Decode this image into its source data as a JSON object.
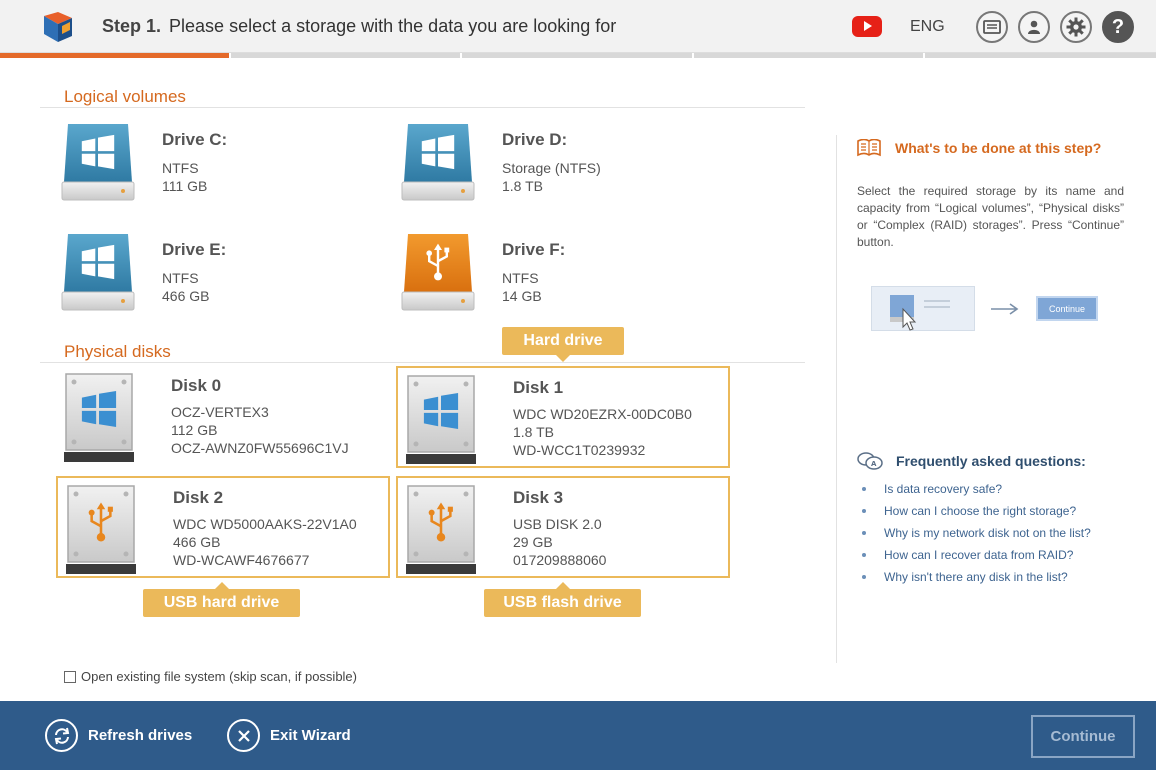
{
  "header": {
    "step_label": "Step 1.",
    "step_text": "Please select a storage with the data you are looking for",
    "language": "ENG",
    "icons": [
      "youtube-icon",
      "log-icon",
      "account-icon",
      "settings-icon",
      "help-icon"
    ],
    "help_glyph": "?"
  },
  "progress": {
    "fraction": 0.2
  },
  "logical_volumes": {
    "title": "Logical volumes",
    "drives": [
      {
        "name": "Drive C:",
        "fs": "NTFS",
        "size": "111 GB",
        "icon": "windows-drive-icon"
      },
      {
        "name": "Drive D:",
        "fs": "Storage (NTFS)",
        "size": "1.8 TB",
        "icon": "windows-drive-icon"
      },
      {
        "name": "Drive E:",
        "fs": "NTFS",
        "size": "466 GB",
        "icon": "windows-drive-icon"
      },
      {
        "name": "Drive F:",
        "fs": "NTFS",
        "size": "14 GB",
        "icon": "usb-drive-icon"
      }
    ]
  },
  "physical_disks": {
    "title": "Physical disks",
    "disks": [
      {
        "name": "Disk 0",
        "model": "OCZ-VERTEX3",
        "size": "112 GB",
        "serial": "OCZ-AWNZ0FW55696C1VJ",
        "icon": "windows-hdd-icon"
      },
      {
        "name": "Disk 1",
        "model": "WDC WD20EZRX-00DC0B0",
        "size": "1.8 TB",
        "serial": "WD-WCC1T0239932",
        "icon": "windows-hdd-icon"
      },
      {
        "name": "Disk 2",
        "model": "WDC WD5000AAKS-22V1A0",
        "size": "466 GB",
        "serial": "WD-WCAWF4676677",
        "icon": "usb-hdd-icon"
      },
      {
        "name": "Disk 3",
        "model": "USB DISK 2.0",
        "size": "29 GB",
        "serial": "017209888060",
        "icon": "usb-hdd-icon"
      }
    ]
  },
  "callouts": {
    "hard_drive": "Hard drive",
    "usb_hard_drive": "USB hard drive",
    "usb_flash_drive": "USB flash drive"
  },
  "options": {
    "open_existing_fs": "Open existing file system (skip scan, if possible)",
    "open_existing_fs_checked": false
  },
  "help": {
    "title": "What's to be done at this step?",
    "text": "Select the required storage by its name and capacity from “Logical volumes”, “Physical disks” or “Complex (RAID) storages”. Press “Continue” button.",
    "illustration_button": "Continue"
  },
  "faq": {
    "title": "Frequently asked questions:",
    "items": [
      "Is data recovery safe?",
      "How can I choose the right storage?",
      "Why is my network disk not on the list?",
      "How can I recover data from RAID?",
      "Why isn't there any disk in the list?"
    ]
  },
  "footer": {
    "refresh_label": "Refresh drives",
    "exit_label": "Exit Wizard",
    "continue_label": "Continue"
  },
  "colors": {
    "accent_orange": "#d5691f",
    "callout_gold": "#ebb95a",
    "footer_blue": "#2f5b8a",
    "drive_blue": "#3f87ad",
    "usb_orange": "#e8871e"
  }
}
